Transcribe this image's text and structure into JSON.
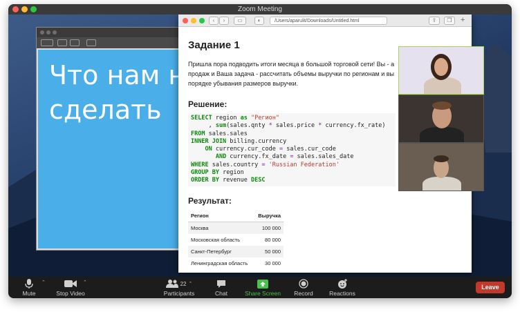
{
  "window": {
    "title": "Zoom Meeting"
  },
  "browser": {
    "url": "/Users/aparulit/Downloads/Untitled.html"
  },
  "slide": {
    "line1": "Что нам н",
    "line2": "сделать"
  },
  "document": {
    "task_title": "Задание 1",
    "task_text_line1": "Пришла пора подводить итоги месяца в большой торговой сети! Вы - а",
    "task_text_line2": "продаж и Ваша задача - рассчитать объемы выручки по регионам и вы",
    "task_text_line3": "порядке убывания размеров выручки.",
    "solution_title": "Решение:",
    "result_title": "Результат:",
    "code": {
      "l1_kw": "SELECT",
      "l1_a": " region ",
      "l1_kw2": "as",
      "l1_str": " \"Регион\"",
      "l2_a": "     , ",
      "l2_kw": "sum",
      "l2_b": "(sales.qnty ",
      "l2_op": "*",
      "l2_c": " sales.price ",
      "l2_op2": "*",
      "l2_d": " currency.fx_rate)",
      "l3_kw": "FROM",
      "l3_a": " sales.sales",
      "l4_kw": "INNER JOIN",
      "l4_a": " billing.currency",
      "l5_pre": "    ",
      "l5_kw": "ON",
      "l5_a": " currency.cur_code ",
      "l5_op": "=",
      "l5_b": " sales.cur_code",
      "l6_pre": "       ",
      "l6_kw": "AND",
      "l6_a": " currency.fx_date ",
      "l6_op": "=",
      "l6_b": " sales.sales_date",
      "l7_kw": "WHERE",
      "l7_a": " sales.country ",
      "l7_op": "=",
      "l7_str": " 'Russian Federation'",
      "l8_kw": "GROUP BY",
      "l8_a": " region",
      "l9_kw": "ORDER BY",
      "l9_a": " revenue ",
      "l9_kw2": "DESC"
    },
    "table": {
      "col1": "Регион",
      "col2": "Выручка",
      "rows": [
        {
          "region": "Москва",
          "revenue": "100 000"
        },
        {
          "region": "Московская область",
          "revenue": "80 000"
        },
        {
          "region": "Санкт-Петербург",
          "revenue": "50 000"
        },
        {
          "region": "Ленинградская область",
          "revenue": "30 000"
        }
      ]
    }
  },
  "toolbar": {
    "mute": "Mute",
    "stop_video": "Stop Video",
    "participants": "Participants",
    "participants_count": "22",
    "chat": "Chat",
    "share_screen": "Share Screen",
    "record": "Record",
    "reactions": "Reactions",
    "leave": "Leave"
  },
  "colors": {
    "share_green": "#4cc04c",
    "leave_red": "#c0392b",
    "slide_blue": "#4aaee8",
    "active_speaker": "#a6d94c"
  }
}
